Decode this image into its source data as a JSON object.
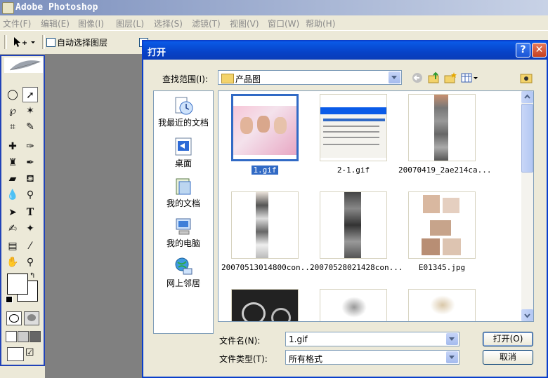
{
  "app": {
    "title": "Adobe Photoshop"
  },
  "menu": [
    "文件(F)",
    "编辑(E)",
    "图像(I)",
    "图层(L)",
    "选择(S)",
    "滤镜(T)",
    "视图(V)",
    "窗口(W)",
    "帮助(H)"
  ],
  "options_bar": {
    "auto_select_label": "自动选择图层"
  },
  "dialog": {
    "title": "打开",
    "look_in_label": "查找范围(I):",
    "look_in_value": "产品图",
    "places": [
      {
        "label": "我最近的文档",
        "icon": "recent-documents-icon"
      },
      {
        "label": "桌面",
        "icon": "desktop-icon"
      },
      {
        "label": "我的文档",
        "icon": "my-documents-icon"
      },
      {
        "label": "我的电脑",
        "icon": "my-computer-icon"
      },
      {
        "label": "网上邻居",
        "icon": "network-places-icon"
      }
    ],
    "files": [
      {
        "name": "1.gif",
        "selected": true
      },
      {
        "name": "2-1.gif",
        "selected": false
      },
      {
        "name": "20070419_2ae214ca...",
        "selected": false
      },
      {
        "name": "20070513014800con...",
        "selected": false
      },
      {
        "name": "20070528021428con...",
        "selected": false
      },
      {
        "name": "E01345.jpg",
        "selected": false
      },
      {
        "name": "",
        "selected": false
      },
      {
        "name": "",
        "selected": false
      },
      {
        "name": "",
        "selected": false
      }
    ],
    "filename_label": "文件名(N):",
    "filename_value": "1.gif",
    "filetype_label": "文件类型(T):",
    "filetype_value": "所有格式",
    "open_button": "打开(O)",
    "cancel_button": "取消"
  },
  "colors": {
    "titlebar": "#0a5be8",
    "selection": "#316ac5",
    "close": "#c5401f"
  }
}
